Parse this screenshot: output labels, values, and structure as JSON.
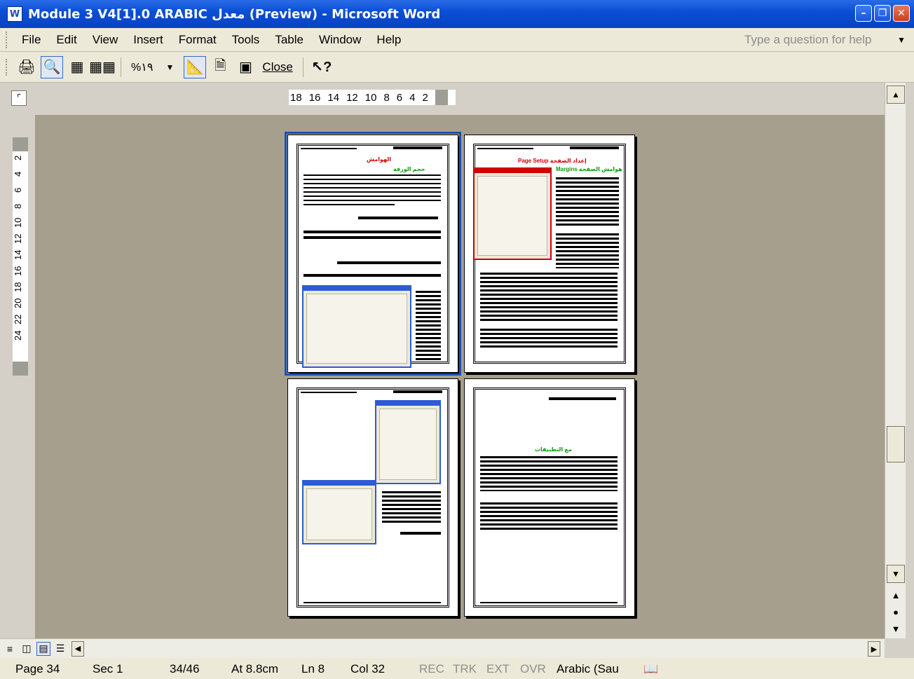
{
  "window": {
    "title": "Module 3 V4[1].0 ARABIC معدل (Preview) - Microsoft Word",
    "app_icon": "W",
    "buttons": [
      "minimize",
      "maximize",
      "close"
    ]
  },
  "menu": {
    "items": [
      {
        "label": "File",
        "accel": "F"
      },
      {
        "label": "Edit",
        "accel": "E"
      },
      {
        "label": "View",
        "accel": "V"
      },
      {
        "label": "Insert",
        "accel": "I"
      },
      {
        "label": "Format",
        "accel": "o"
      },
      {
        "label": "Tools",
        "accel": "T"
      },
      {
        "label": "Table",
        "accel": "a"
      },
      {
        "label": "Window",
        "accel": "W"
      },
      {
        "label": "Help",
        "accel": "H"
      }
    ],
    "help_placeholder": "Type a question for help"
  },
  "toolbar": {
    "zoom": "%١٩",
    "close_label": "Close",
    "icons": [
      "print-icon",
      "magnifier-icon",
      "one-page-icon",
      "multiple-pages-icon",
      "view-ruler-icon",
      "shrink-to-fit-icon",
      "full-screen-icon",
      "context-help-icon"
    ]
  },
  "ruler": {
    "horizontal_ticks": [
      "18",
      "16",
      "14",
      "12",
      "10",
      "8",
      "6",
      "4",
      "2"
    ],
    "vertical_ticks": [
      "2",
      "2",
      "4",
      "6",
      "8",
      "10",
      "12",
      "14",
      "16",
      "18",
      "20",
      "22",
      "24"
    ]
  },
  "pages": [
    {
      "id": 34,
      "selected": true
    },
    {
      "id": 35,
      "selected": false
    },
    {
      "id": 36,
      "selected": false
    },
    {
      "id": 37,
      "selected": false
    }
  ],
  "page_text": {
    "p34_red_title": "الهوامش",
    "p34_green_title": "حجم الورقة",
    "p35_red_title": "Page Setup إعداد الصفحة",
    "p35_green_title": "Margins هوامش الصفحة",
    "p37_green_title": "مع التطبيقات"
  },
  "statusbar": {
    "page": "Page 34",
    "sec": "Sec 1",
    "pages": "34/46",
    "at": "At 8.8cm",
    "ln": "Ln 8",
    "col": "Col 32",
    "rec": "REC",
    "trk": "TRK",
    "ext": "EXT",
    "ovr": "OVR",
    "language": "Arabic (Sau"
  }
}
